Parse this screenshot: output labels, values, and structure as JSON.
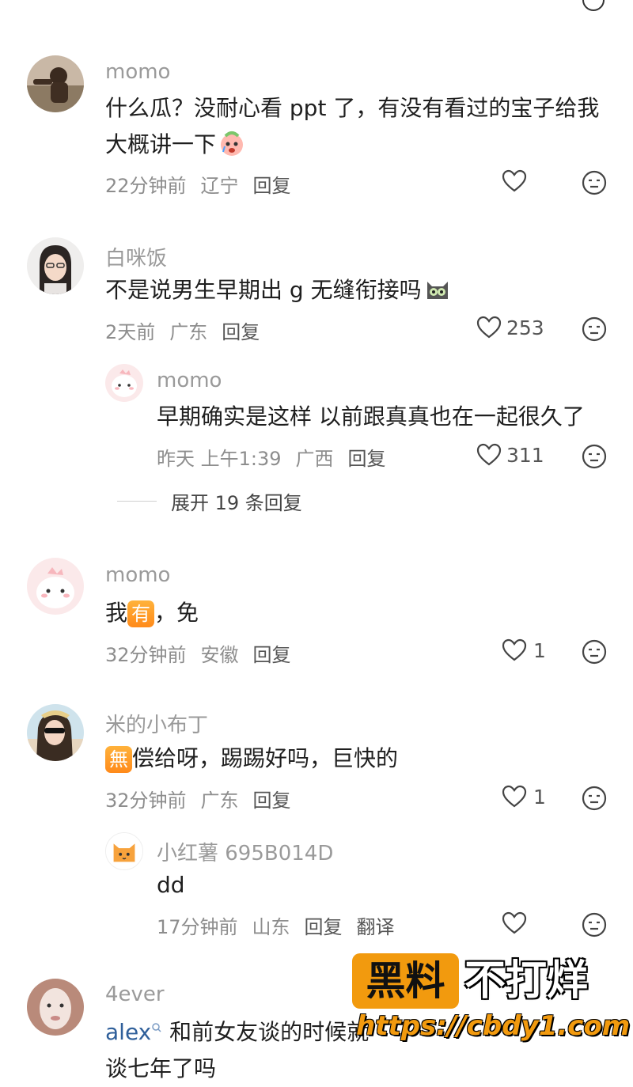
{
  "comments": [
    {
      "username": "momo",
      "text_line1": "什么瓜？没耐心看 ppt 了，有没有看过的宝子给我",
      "text_line2": "大概讲一下",
      "time": "22分钟前",
      "location": "辽宁",
      "reply_label": "回复",
      "likes": ""
    },
    {
      "username": "白咪饭",
      "text": "不是说男生早期出 g 无缝衔接吗",
      "time": "2天前",
      "location": "广东",
      "reply_label": "回复",
      "likes": "253",
      "reply": {
        "username": "momo",
        "text": "早期确实是这样 以前跟真真也在一起很久了",
        "time": "昨天 上午1:39",
        "location": "广西",
        "reply_label": "回复",
        "likes": "311"
      },
      "expand_label": "展开 19 条回复"
    },
    {
      "username": "momo",
      "text_before": "我",
      "badge": "有",
      "text_after": "，免",
      "time": "32分钟前",
      "location": "安徽",
      "reply_label": "回复",
      "likes": "1"
    },
    {
      "username": "米的小布丁",
      "badge": "無",
      "text_after": "偿给呀，踢踢好吗，巨快的",
      "time": "32分钟前",
      "location": "广东",
      "reply_label": "回复",
      "likes": "1",
      "reply": {
        "username": "小红薯 695B014D",
        "text": "dd",
        "time": "17分钟前",
        "location": "山东",
        "reply_label": "回复",
        "translate_label": "翻译",
        "likes": ""
      }
    },
    {
      "username": "4ever",
      "mention": "alex",
      "text": " 和前女友谈的时候就",
      "text_line2": "谈七年了吗"
    }
  ],
  "watermark": {
    "box": "黑料",
    "text": "不打烊",
    "url": "https://cbdy1.com"
  },
  "colors": {
    "accent_badge": "#ff9a28",
    "watermark_orange": "#f29a0e",
    "mention": "#2f5f9a"
  }
}
